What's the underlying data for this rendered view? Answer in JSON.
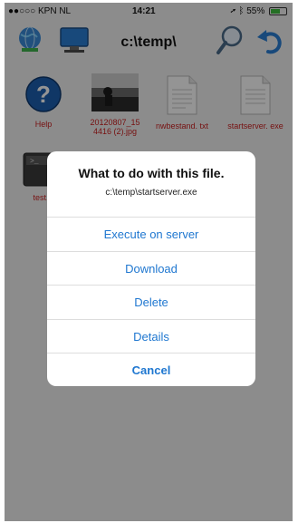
{
  "status_bar": {
    "carrier": "●●○○○ KPN NL",
    "time": "14:21",
    "battery_pct": "55%"
  },
  "toolbar": {
    "path": "c:\\temp\\"
  },
  "files": [
    {
      "label": "Help",
      "icon": "help-icon"
    },
    {
      "label": "20120807_15 4416 (2).jpg",
      "icon": "photo-thumbnail"
    },
    {
      "label": "nwbestand. txt",
      "icon": "document-icon"
    },
    {
      "label": "startserver. exe",
      "icon": "document-icon"
    },
    {
      "label": "test.",
      "icon": "console-icon"
    }
  ],
  "dialog": {
    "title": "What to do with this file.",
    "subtitle": "c:\\temp\\startserver.exe",
    "options": [
      "Execute on server",
      "Download",
      "Delete",
      "Details"
    ],
    "cancel": "Cancel"
  },
  "colors": {
    "accent": "#1f77d0",
    "file_label": "#cc1f1f"
  }
}
